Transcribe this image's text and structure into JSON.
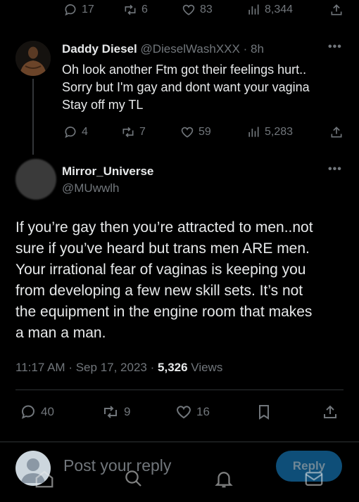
{
  "top_actions": {
    "replies": "17",
    "reposts": "6",
    "likes": "83",
    "views": "8,344"
  },
  "reply_tweet": {
    "display_name": "Daddy Diesel",
    "handle": "@DieselWashXXX",
    "separator": "·",
    "time": "8h",
    "lines": [
      "Oh look another Ftm got their feelings hurt..",
      "Sorry but I'm gay and dont want your vagina",
      "Stay off my TL"
    ],
    "replies": "4",
    "reposts": "7",
    "likes": "59",
    "views": "5,283"
  },
  "main_tweet": {
    "display_name": "Mirror_Universe",
    "handle": "@MUwwlh",
    "lines": [
      "If you’re gay then you’re attracted to men..not",
      "sure if you’ve heard but trans men ARE men.",
      "Your irrational fear of vaginas is keeping you",
      "from developing a few new skill sets.  It’s not",
      "the equipment in the engine room that makes",
      "a man a man."
    ],
    "time": "11:17 AM",
    "date_separator": "·",
    "date": "Sep 17, 2023",
    "views_separator": "·",
    "view_count": "5,326",
    "views_label": "Views",
    "replies": "40",
    "reposts": "9",
    "likes": "16"
  },
  "reply_composer": {
    "placeholder": "Post your reply",
    "button_label": "Reply"
  },
  "colors": {
    "background": "#000000",
    "text": "#e7e9ea",
    "muted": "#71767b",
    "accent": "#1d9bf0"
  }
}
